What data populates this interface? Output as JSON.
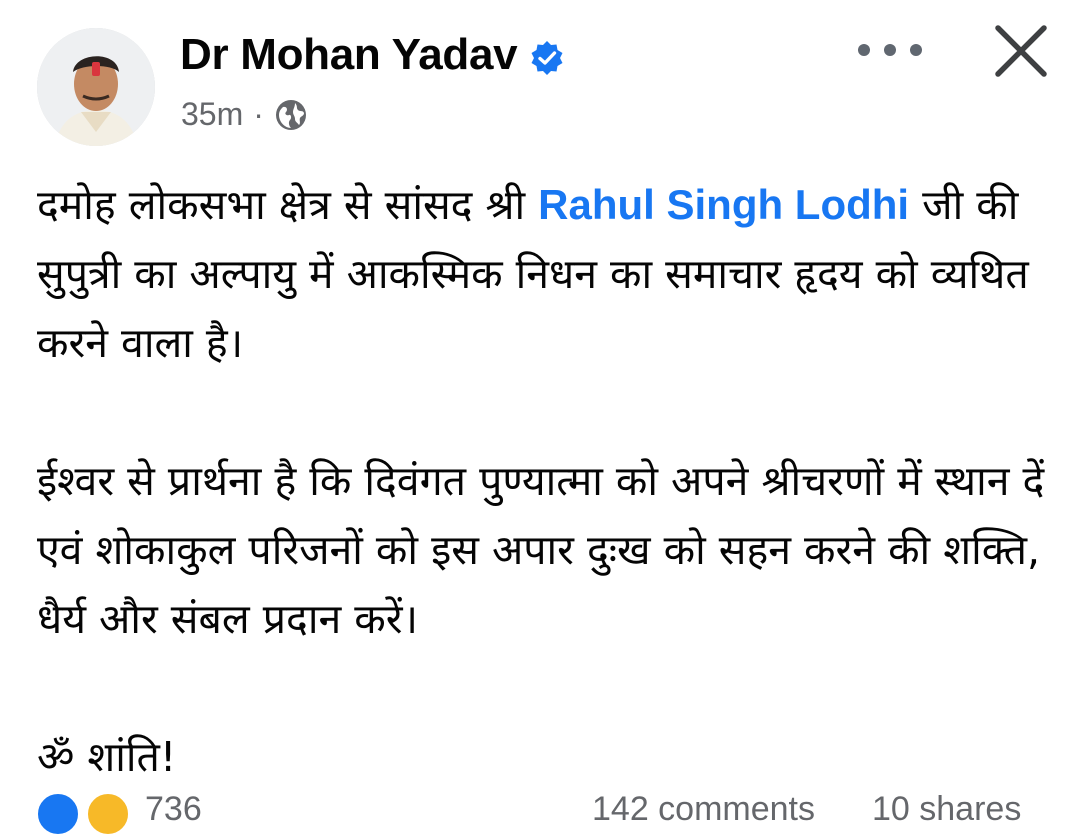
{
  "post": {
    "author": "Dr Mohan Yadav",
    "time": "35m",
    "separator": "·",
    "audience_icon": "globe-icon",
    "verified_icon": "verified-badge-icon",
    "more_icon": "more-options-icon",
    "close_icon": "close-icon",
    "body": {
      "p1_before": "दमोह लोकसभा क्षेत्र से सांसद श्री ",
      "p1_mention": "Rahul Singh Lodhi",
      "p1_after": " जी की सुपुत्री का अल्पायु में आकस्मिक निधन का समाचार हृदय को व्यथित करने वाला है।",
      "p2": "ईश्वर से प्रार्थना है कि दिवंगत पुण्यात्मा को अपने श्रीचरणों में स्थान दें एवं शोकाकुल परिजनों को इस अपार दुःख को सहन करने की शक्ति, धैर्य और संबल प्रदान करें।",
      "p3": "ॐ शांति!"
    }
  },
  "footer": {
    "reaction_count": "736",
    "comments": "142 comments",
    "shares": "10 shares"
  },
  "colors": {
    "mention": "#1877f2",
    "verified": "#1877f2",
    "meta": "#65676b"
  }
}
